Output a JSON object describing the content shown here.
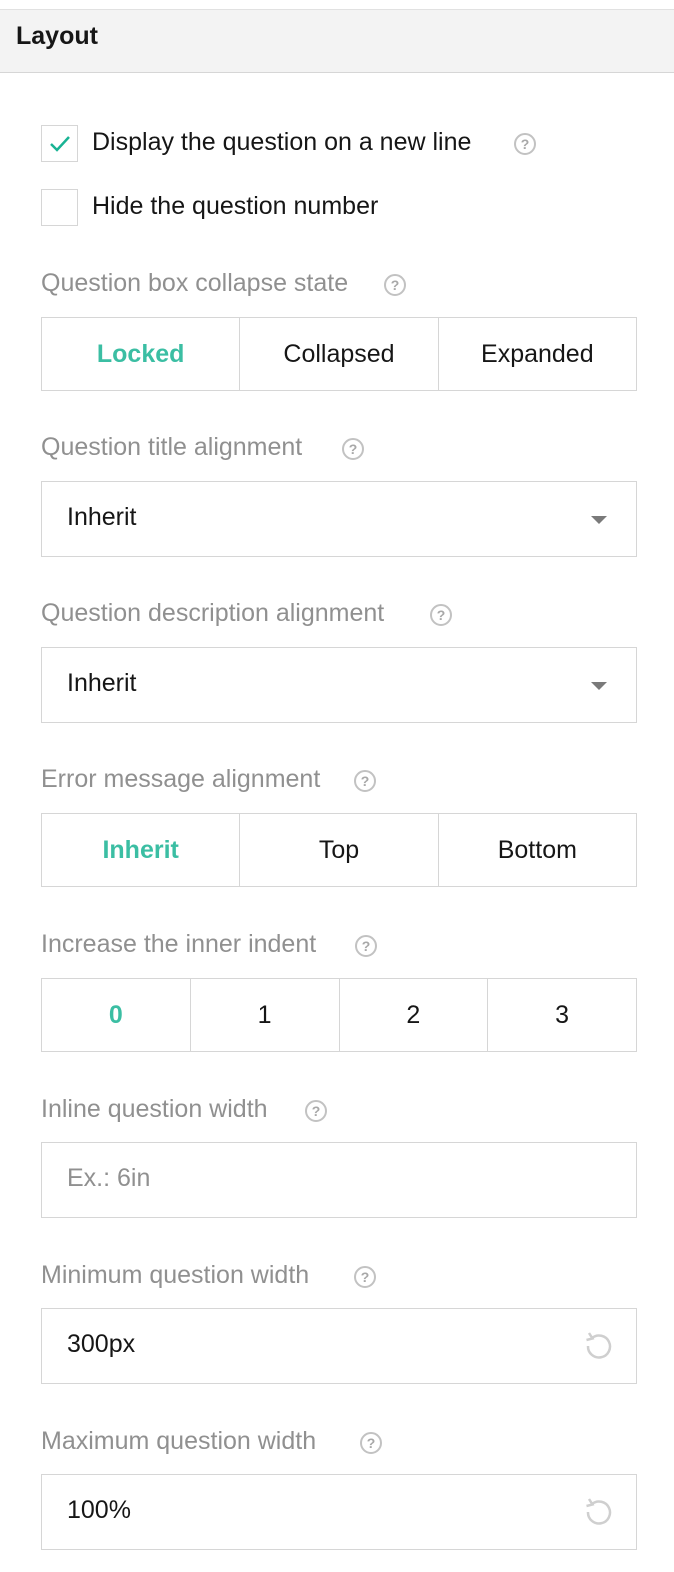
{
  "section": {
    "title": "Layout"
  },
  "checkboxes": [
    {
      "label": "Display the question on a new line",
      "checked": true,
      "help": "?"
    },
    {
      "label": "Hide the question number",
      "checked": false
    }
  ],
  "collapse_state": {
    "label": "Question box collapse state",
    "help": "?",
    "options": [
      "Locked",
      "Collapsed",
      "Expanded"
    ],
    "selected": "Locked"
  },
  "title_alignment": {
    "label": "Question title alignment",
    "help": "?",
    "value": "Inherit"
  },
  "description_alignment": {
    "label": "Question description alignment",
    "help": "?",
    "value": "Inherit"
  },
  "error_alignment": {
    "label": "Error message alignment",
    "help": "?",
    "options": [
      "Inherit",
      "Top",
      "Bottom"
    ],
    "selected": "Inherit"
  },
  "inner_indent": {
    "label": "Increase the inner indent",
    "help": "?",
    "options": [
      "0",
      "1",
      "2",
      "3"
    ],
    "selected": "0"
  },
  "inline_width": {
    "label": "Inline question width",
    "help": "?",
    "value": "",
    "placeholder": "Ex.: 6in"
  },
  "min_width": {
    "label": "Minimum question width",
    "help": "?",
    "value": "300px"
  },
  "max_width": {
    "label": "Maximum question width",
    "help": "?",
    "value": "100%"
  },
  "colors": {
    "accent": "#19b394",
    "label": "#909090",
    "border": "#d6d6d6",
    "text": "#161616"
  },
  "icons": {
    "check": "check-icon",
    "help": "help-circle-icon",
    "dropdown": "chevron-down-icon",
    "reset": "reset-icon"
  }
}
